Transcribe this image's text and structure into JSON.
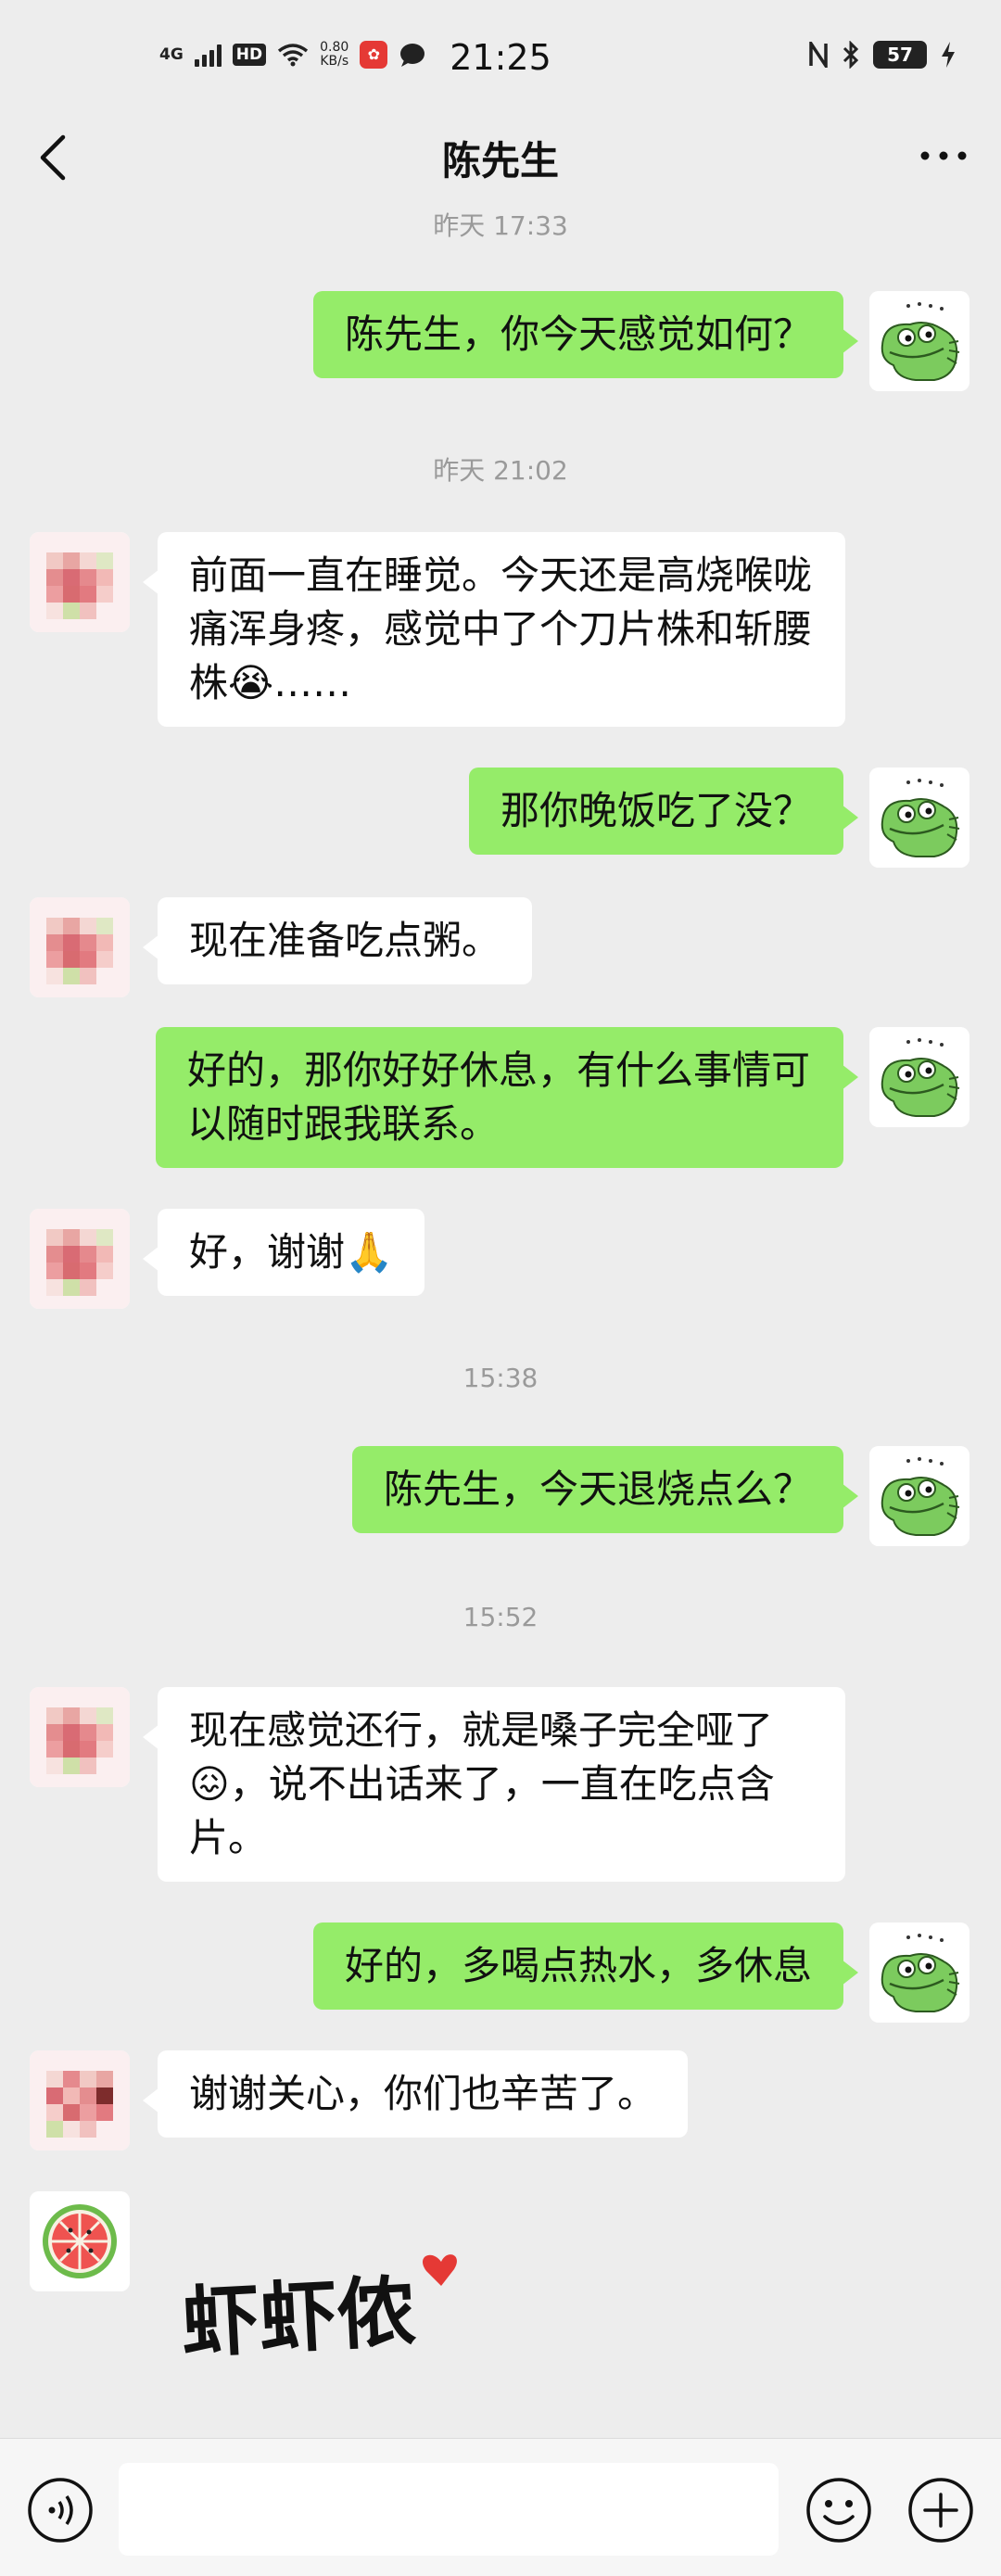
{
  "status_bar": {
    "network": "4G",
    "hd": "HD",
    "speed_value": "0.80",
    "speed_unit": "KB/s",
    "time": "21:25",
    "battery": "57"
  },
  "nav": {
    "title": "陈先生"
  },
  "timestamps": [
    "昨天 17:33",
    "昨天 21:02",
    "15:38",
    "15:52"
  ],
  "messages": [
    {
      "from": "me",
      "text": "陈先生，你今天感觉如何？"
    },
    {
      "from": "other",
      "text": "前面一直在睡觉。今天还是高烧喉咙痛浑身疼，感觉中了个刀片株和斩腰株😭……"
    },
    {
      "from": "me",
      "text": "那你晚饭吃了没？"
    },
    {
      "from": "other",
      "text": "现在准备吃点粥。"
    },
    {
      "from": "me",
      "text": "好的，那你好好休息，有什么事情可以随时跟我联系。"
    },
    {
      "from": "other",
      "text": "好，谢谢🙏"
    },
    {
      "from": "me",
      "text": "陈先生，今天退烧点么？"
    },
    {
      "from": "other",
      "text": "现在感觉还行，就是嗓子完全哑了😖，说不出话来了，一直在吃点含片。"
    },
    {
      "from": "me",
      "text": "好的，多喝点热水，多休息"
    },
    {
      "from": "other",
      "text": "谢谢关心，你们也辛苦了。"
    }
  ],
  "sticker": {
    "text": "虾虾侬"
  },
  "icons": {
    "back": "chevron-left-icon",
    "more": "more-dots-icon",
    "voice": "voice-icon",
    "emoji": "emoji-icon",
    "plus": "plus-icon"
  },
  "colors": {
    "background": "#ededed",
    "my_bubble": "#95ec69",
    "other_bubble": "#ffffff",
    "timestamp": "#9a9a9a"
  }
}
